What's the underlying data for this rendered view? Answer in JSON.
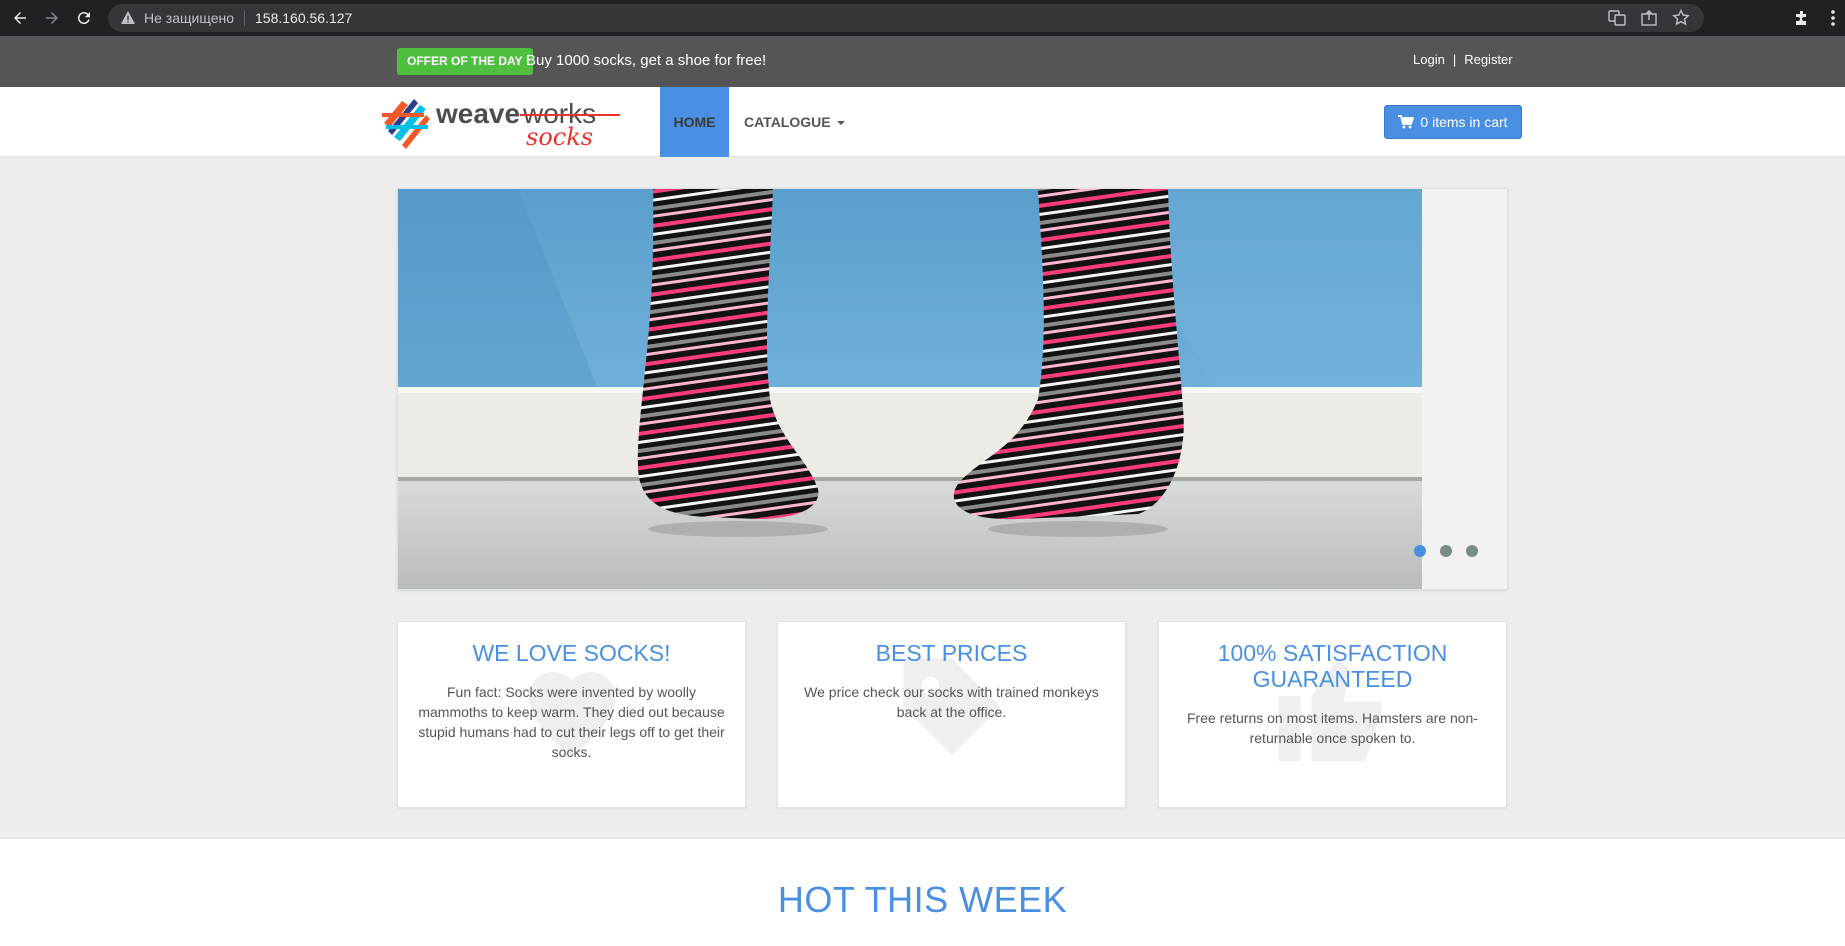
{
  "browser": {
    "security_label": "Не защищено",
    "url": "158.160.56.127"
  },
  "top_bar": {
    "offer_badge": "OFFER OF THE DAY",
    "offer_text": "Buy 1000 socks, get a shoe for free!",
    "login": "Login",
    "separator": "|",
    "register": "Register"
  },
  "navbar": {
    "home": "HOME",
    "catalogue": "CATALOGUE",
    "cart": "0 items in cart"
  },
  "carousel": {
    "slide_count": 3,
    "active_slide": 1
  },
  "features": [
    {
      "title": "WE LOVE SOCKS!",
      "text": "Fun fact: Socks were invented by woolly mammoths to keep warm. They died out because stupid humans had to cut their legs off to get their socks.",
      "icon": "heart-icon"
    },
    {
      "title": "BEST PRICES",
      "text": "We price check our socks with trained monkeys back at the office.",
      "icon": "tag-icon"
    },
    {
      "title": "100% SATISFACTION GUARANTEED",
      "text": "Free returns on most items. Hamsters are non-returnable once spoken to.",
      "icon": "thumbs-up-icon"
    }
  ],
  "hot": {
    "title": "HOT THIS WEEK"
  },
  "colors": {
    "accent": "#4a90e2",
    "offer_green": "#4fbf40",
    "top_bar": "#555555"
  }
}
